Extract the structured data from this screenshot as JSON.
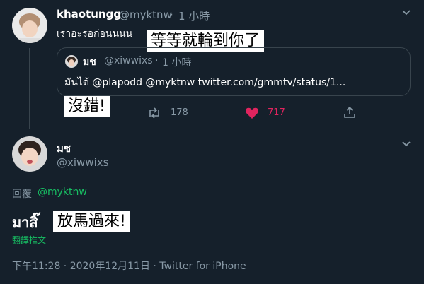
{
  "tweet1": {
    "display_name": "khaotungg",
    "handle": "@myktnw",
    "sep": "·",
    "time": "1 小時",
    "text": "เราอะรอก่อนนนน",
    "translation_overlay": "等等就輪到你了",
    "quote": {
      "display_name": "มช",
      "handle": "@xiwwixs",
      "sep": "·",
      "time": "1 小時",
      "text": "มันได้ @plapodd  @myktnw twitter.com/gmmtv/status/1..."
    },
    "overlay2": "沒錯!",
    "actions": {
      "retweet_count": "178",
      "like_count": "717"
    }
  },
  "tweet2": {
    "display_name": "มช",
    "handle": "@xiwwixs",
    "reply_label": "回覆",
    "reply_to": "@myktnw",
    "text": "มาสิ๊",
    "translation_overlay": "放馬過來!",
    "translate_link": "翻譯推文",
    "meta": "下午11:28 · 2020年12月11日 · Twitter for iPhone"
  },
  "colors": {
    "background": "#15202b",
    "muted": "#8899a6",
    "like": "#e0245e",
    "link_green": "#17bf63",
    "border": "#38444d"
  },
  "icons": [
    "chevron-down-icon",
    "reply-icon",
    "retweet-icon",
    "heart-icon",
    "share-icon"
  ]
}
